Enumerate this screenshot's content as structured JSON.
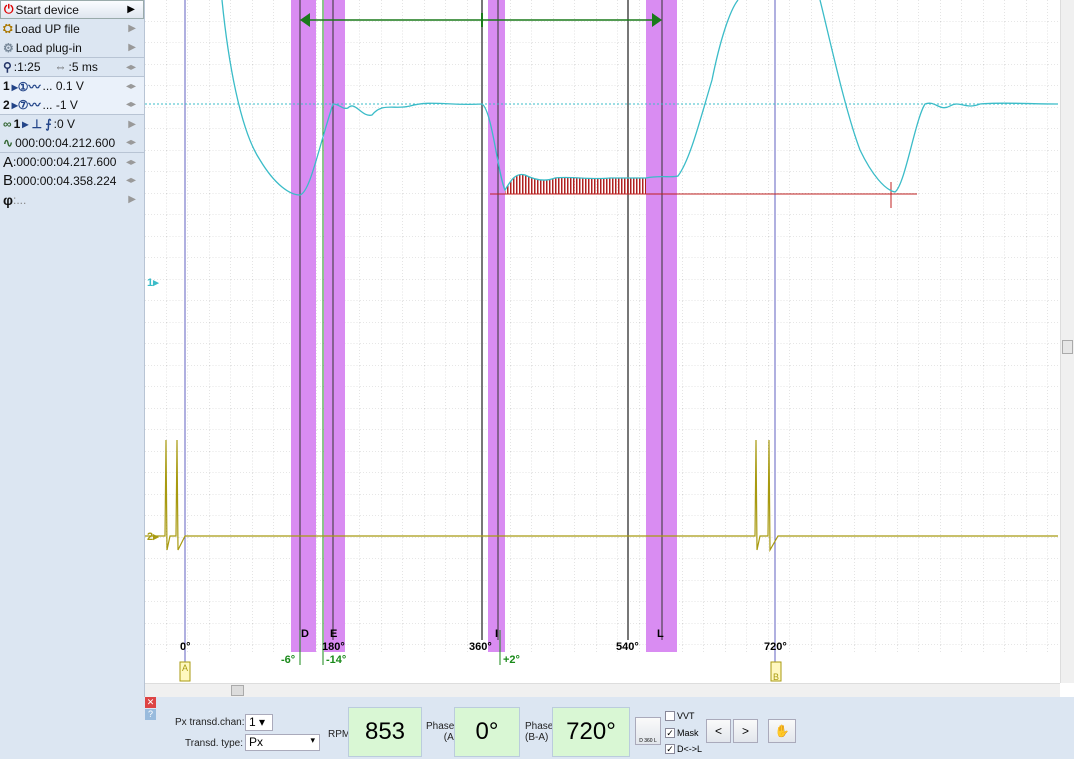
{
  "sidebar": {
    "start_device": "Start device",
    "load_up_file": "Load UP file",
    "load_plugin": "Load plug-in",
    "zoom": ":1:25",
    "timebase": ":5 ms",
    "ch1": "1",
    "ch1_range": "... 0.1 V",
    "ch2": "2",
    "ch2_range": "... -1 V",
    "trigger": "1",
    "trigger_level": ":0 V",
    "trigger_time": "000:00:04.212.600",
    "cursor_a_label": "A",
    "cursor_a": ":000:00:04.217.600",
    "cursor_b_label": "B",
    "cursor_b": ":000:00:04.358.224",
    "phi_label": "φ",
    "phi": ":..."
  },
  "plot": {
    "channel_markers": [
      "1▸",
      "2▸"
    ],
    "degree_labels": [
      "0°",
      "180°",
      "360°",
      "540°",
      "720°"
    ],
    "band_labels": [
      "D",
      "E",
      "I",
      "L"
    ],
    "offset_labels": [
      "-6°",
      "-14°",
      "+2°"
    ],
    "cursor_tags": [
      "A",
      "B"
    ],
    "colors": {
      "ch1": "#3bbcc8",
      "ch2": "#a89a10",
      "band": "#d98cf2",
      "offset": "#1a8a1a",
      "area": "#b02020"
    }
  },
  "bottom": {
    "px_chan_label": "Px transd.chan:",
    "px_chan_value": "1",
    "transd_type_label": "Transd. type:",
    "transd_type_value": "Px",
    "rpm_label": "RPM:",
    "rpm_value": "853",
    "phase_a_label": "Phase:",
    "phase_a_sub": "(A)",
    "phase_a_value": "0°",
    "phase_ba_label": "Phase:",
    "phase_ba_sub": "(B-A)",
    "phase_ba_value": "720°",
    "dl_button": "D 360 L",
    "vvt_label": "VVT",
    "vvt_checked": false,
    "mask_label": "Mask",
    "mask_checked": true,
    "dl_label": "D<->L",
    "dl_checked": true,
    "prev": "<",
    "next": ">"
  }
}
